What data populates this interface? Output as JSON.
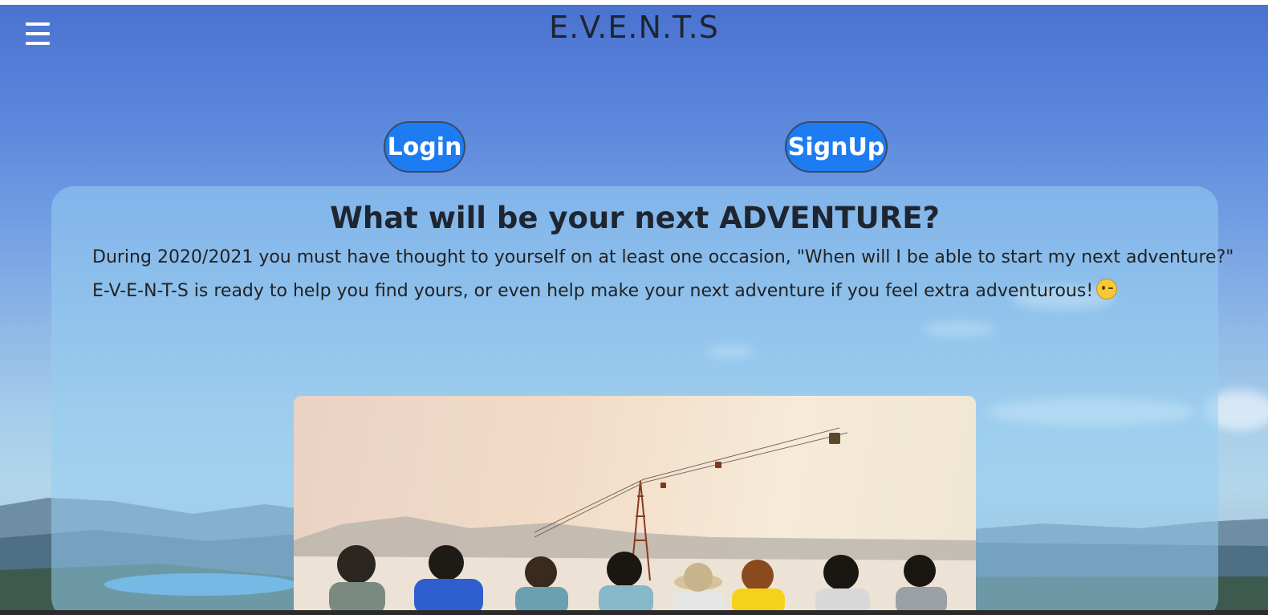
{
  "header": {
    "site_title": "E.V.E.N.T.S",
    "menu_icon": "hamburger-menu-icon"
  },
  "auth": {
    "login_label": "Login",
    "signup_label": "SignUp"
  },
  "hero": {
    "heading": "What will be your next ADVENTURE?",
    "line1": "During 2020/2021 you must have thought to yourself on at least one occasion, \"When will I be able to start my next adventure?\"",
    "line2": "E-V-E-N-T-S is ready to help you find yours, or even help make your next adventure if you feel extra adventurous!",
    "emoji": "winking-face-icon"
  },
  "colors": {
    "button_bg": "#1e7cf2",
    "panel_bg": "rgba(150,205,240,0.55)",
    "title_text": "#1f2530"
  }
}
